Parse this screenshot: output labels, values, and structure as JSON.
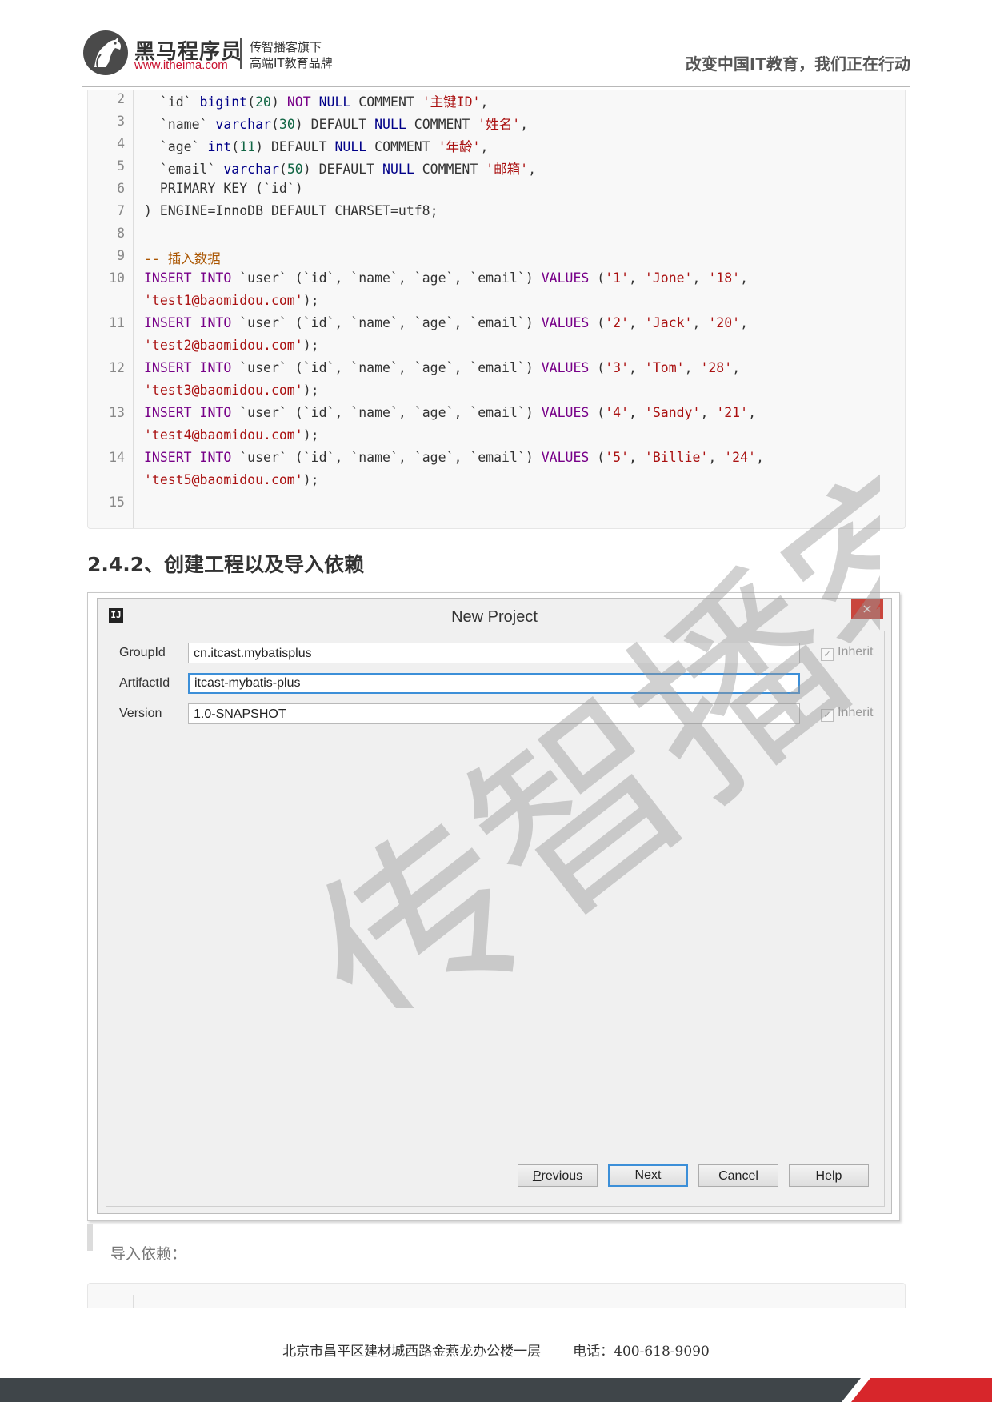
{
  "header": {
    "brand_name": "黑马程序员",
    "brand_url": "www.itheima.com",
    "brand_sub_1": "传智播客旗下",
    "brand_sub_2": "高端IT教育品牌",
    "slogan": "改变中国IT教育，我们正在行动"
  },
  "code_block": {
    "lines": [
      {
        "n": "2",
        "parts": [
          [
            "bq",
            "  `id` "
          ],
          [
            "ty",
            "bigint"
          ],
          [
            "bq",
            "("
          ],
          [
            "num",
            "20"
          ],
          [
            "bq",
            ") "
          ],
          [
            "kw",
            "NOT"
          ],
          [
            "bq",
            " "
          ],
          [
            "ty",
            "NULL"
          ],
          [
            "bq",
            " COMMENT "
          ],
          [
            "str",
            "'主键ID'"
          ],
          [
            "bq",
            ","
          ]
        ]
      },
      {
        "n": "3",
        "parts": [
          [
            "bq",
            "  `name` "
          ],
          [
            "ty",
            "varchar"
          ],
          [
            "bq",
            "("
          ],
          [
            "num",
            "30"
          ],
          [
            "bq",
            ") DEFAULT "
          ],
          [
            "ty",
            "NULL"
          ],
          [
            "bq",
            " COMMENT "
          ],
          [
            "str",
            "'姓名'"
          ],
          [
            "bq",
            ","
          ]
        ]
      },
      {
        "n": "4",
        "parts": [
          [
            "bq",
            "  `age` "
          ],
          [
            "ty",
            "int"
          ],
          [
            "bq",
            "("
          ],
          [
            "num",
            "11"
          ],
          [
            "bq",
            ") DEFAULT "
          ],
          [
            "ty",
            "NULL"
          ],
          [
            "bq",
            " COMMENT "
          ],
          [
            "str",
            "'年龄'"
          ],
          [
            "bq",
            ","
          ]
        ]
      },
      {
        "n": "5",
        "parts": [
          [
            "bq",
            "  `email` "
          ],
          [
            "ty",
            "varchar"
          ],
          [
            "bq",
            "("
          ],
          [
            "num",
            "50"
          ],
          [
            "bq",
            ") DEFAULT "
          ],
          [
            "ty",
            "NULL"
          ],
          [
            "bq",
            " COMMENT "
          ],
          [
            "str",
            "'邮箱'"
          ],
          [
            "bq",
            ","
          ]
        ]
      },
      {
        "n": "6",
        "parts": [
          [
            "bq",
            "  PRIMARY KEY (`id`)"
          ]
        ]
      },
      {
        "n": "7",
        "parts": [
          [
            "bq",
            ") ENGINE=InnoDB DEFAULT CHARSET=utf8;"
          ]
        ]
      },
      {
        "n": "8",
        "parts": []
      },
      {
        "n": "9",
        "parts": [
          [
            "cm",
            "-- 插入数据"
          ]
        ]
      },
      {
        "n": "10",
        "parts": [
          [
            "kw",
            "INSERT"
          ],
          [
            "bq",
            " "
          ],
          [
            "kw",
            "INTO"
          ],
          [
            "bq",
            " `user` (`id`, `name`, `age`, `email`) "
          ],
          [
            "kw",
            "VALUES"
          ],
          [
            "bq",
            " ("
          ],
          [
            "str",
            "'1'"
          ],
          [
            "bq",
            ", "
          ],
          [
            "str",
            "'Jone'"
          ],
          [
            "bq",
            ", "
          ],
          [
            "str",
            "'18'"
          ],
          [
            "bq",
            ","
          ]
        ]
      },
      {
        "n": "",
        "parts": [
          [
            "str",
            "'test1@baomidou.com'"
          ],
          [
            "bq",
            ");"
          ]
        ]
      },
      {
        "n": "11",
        "parts": [
          [
            "kw",
            "INSERT"
          ],
          [
            "bq",
            " "
          ],
          [
            "kw",
            "INTO"
          ],
          [
            "bq",
            " `user` (`id`, `name`, `age`, `email`) "
          ],
          [
            "kw",
            "VALUES"
          ],
          [
            "bq",
            " ("
          ],
          [
            "str",
            "'2'"
          ],
          [
            "bq",
            ", "
          ],
          [
            "str",
            "'Jack'"
          ],
          [
            "bq",
            ", "
          ],
          [
            "str",
            "'20'"
          ],
          [
            "bq",
            ","
          ]
        ]
      },
      {
        "n": "",
        "parts": [
          [
            "str",
            "'test2@baomidou.com'"
          ],
          [
            "bq",
            ");"
          ]
        ]
      },
      {
        "n": "12",
        "parts": [
          [
            "kw",
            "INSERT"
          ],
          [
            "bq",
            " "
          ],
          [
            "kw",
            "INTO"
          ],
          [
            "bq",
            " `user` (`id`, `name`, `age`, `email`) "
          ],
          [
            "kw",
            "VALUES"
          ],
          [
            "bq",
            " ("
          ],
          [
            "str",
            "'3'"
          ],
          [
            "bq",
            ", "
          ],
          [
            "str",
            "'Tom'"
          ],
          [
            "bq",
            ", "
          ],
          [
            "str",
            "'28'"
          ],
          [
            "bq",
            ","
          ]
        ]
      },
      {
        "n": "",
        "parts": [
          [
            "str",
            "'test3@baomidou.com'"
          ],
          [
            "bq",
            ");"
          ]
        ]
      },
      {
        "n": "13",
        "parts": [
          [
            "kw",
            "INSERT"
          ],
          [
            "bq",
            " "
          ],
          [
            "kw",
            "INTO"
          ],
          [
            "bq",
            " `user` (`id`, `name`, `age`, `email`) "
          ],
          [
            "kw",
            "VALUES"
          ],
          [
            "bq",
            " ("
          ],
          [
            "str",
            "'4'"
          ],
          [
            "bq",
            ", "
          ],
          [
            "str",
            "'Sandy'"
          ],
          [
            "bq",
            ", "
          ],
          [
            "str",
            "'21'"
          ],
          [
            "bq",
            ","
          ]
        ]
      },
      {
        "n": "",
        "parts": [
          [
            "str",
            "'test4@baomidou.com'"
          ],
          [
            "bq",
            ");"
          ]
        ]
      },
      {
        "n": "14",
        "parts": [
          [
            "kw",
            "INSERT"
          ],
          [
            "bq",
            " "
          ],
          [
            "kw",
            "INTO"
          ],
          [
            "bq",
            " `user` (`id`, `name`, `age`, `email`) "
          ],
          [
            "kw",
            "VALUES"
          ],
          [
            "bq",
            " ("
          ],
          [
            "str",
            "'5'"
          ],
          [
            "bq",
            ", "
          ],
          [
            "str",
            "'Billie'"
          ],
          [
            "bq",
            ", "
          ],
          [
            "str",
            "'24'"
          ],
          [
            "bq",
            ","
          ]
        ]
      },
      {
        "n": "",
        "parts": [
          [
            "str",
            "'test5@baomidou.com'"
          ],
          [
            "bq",
            ");"
          ]
        ]
      },
      {
        "n": "15",
        "parts": []
      }
    ],
    "colors": {
      "keyword": "#770088",
      "type": "#000088",
      "number": "#116644",
      "string": "#aa1111",
      "comment": "#aa5500"
    }
  },
  "section_heading": "2.4.2、创建工程以及导入依赖",
  "dialog": {
    "title": "New Project",
    "title_icon": "IJ",
    "close_icon": "×",
    "fields": {
      "group_label": "GroupId",
      "group_value": "cn.itcast.mybatisplus",
      "artifact_label": "ArtifactId",
      "artifact_value": "itcast-mybatis-plus",
      "version_label": "Version",
      "version_value": "1.0-SNAPSHOT",
      "inherit_label": "Inherit",
      "check_mark": "✓"
    },
    "buttons": {
      "previous_mnemonic": "P",
      "previous_rest": "revious",
      "next_mnemonic": "N",
      "next_rest": "ext",
      "cancel": "Cancel",
      "help": "Help"
    }
  },
  "watermark": "传智播客",
  "quote_text": "导入依赖：",
  "footer": {
    "address": "北京市昌平区建材城西路金燕龙办公楼一层",
    "phone": "电话：400-618-9090"
  },
  "accent_colors": {
    "brand_red": "#c8102e",
    "footer_dark": "#3f4549",
    "footer_red": "#d7262b"
  }
}
